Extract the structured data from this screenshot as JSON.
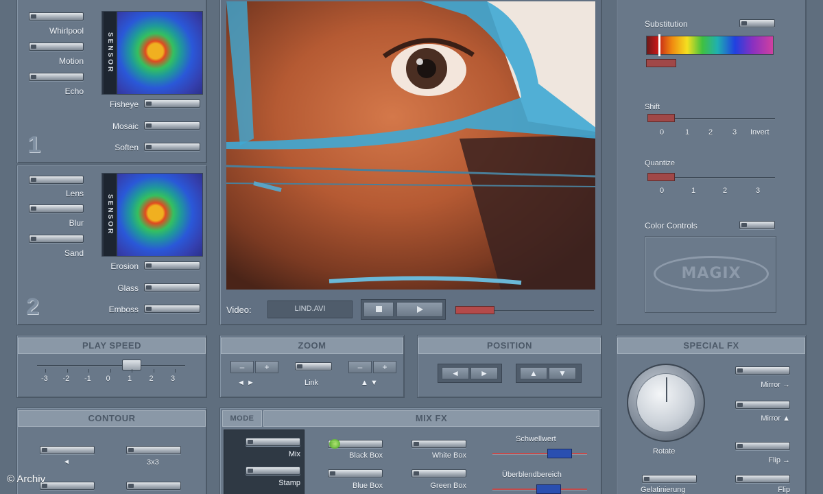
{
  "panel1": {
    "effects_left": [
      "Whirlpool",
      "Motion",
      "Echo"
    ],
    "effects_right": [
      "Fisheye",
      "Mosaic",
      "Soften"
    ],
    "number": "1",
    "sensor_label": "SENSOR"
  },
  "panel2": {
    "effects_left": [
      "Lens",
      "Blur",
      "Sand"
    ],
    "effects_right": [
      "Erosion",
      "Glass",
      "Emboss"
    ],
    "number": "2",
    "sensor_label": "SENSOR"
  },
  "video": {
    "label": "Video:",
    "filename": "LIND.AVI",
    "progress": 0.28
  },
  "right_panel": {
    "substitution_label": "Substitution",
    "shift_label": "Shift",
    "shift_ticks": [
      "0",
      "1",
      "2",
      "3",
      "Invert"
    ],
    "quantize_label": "Quantize",
    "quantize_ticks": [
      "0",
      "1",
      "2",
      "3"
    ],
    "color_controls_label": "Color Controls",
    "logo_text": "MAGIX"
  },
  "play_speed": {
    "title": "PLAY SPEED",
    "ticks": [
      "-3",
      "-2",
      "-1",
      "0",
      "1",
      "2",
      "3"
    ],
    "value": 1
  },
  "zoom": {
    "title": "ZOOM",
    "minus": "–",
    "plus": "+",
    "h_arrows": "◄ ►",
    "v_arrows": "▲ ▼",
    "link_label": "Link"
  },
  "position": {
    "title": "POSITION",
    "left": "◄",
    "right": "►",
    "up": "▲",
    "down": "▼"
  },
  "special_fx": {
    "title": "SPECIAL FX",
    "rotate_label": "Rotate",
    "mirror_h_label": "Mirror →",
    "mirror_v_label": "Mirror ▲",
    "flip_h_label": "Flip →",
    "flip_v_label": "Flip",
    "extra_label": "Gelatinierung"
  },
  "contour": {
    "title": "CONTOUR",
    "arrow_label": "◄",
    "size_label": "3x3"
  },
  "mix_fx": {
    "mode_tab": "MODE",
    "title": "MIX FX",
    "modes": [
      "Mix",
      "Stamp"
    ],
    "boxes": [
      "Black Box",
      "White Box",
      "Blue Box",
      "Green Box"
    ],
    "threshold_label": "Schwellwert",
    "blend_label": "Überblendbereich"
  },
  "watermark": "© Archiv"
}
